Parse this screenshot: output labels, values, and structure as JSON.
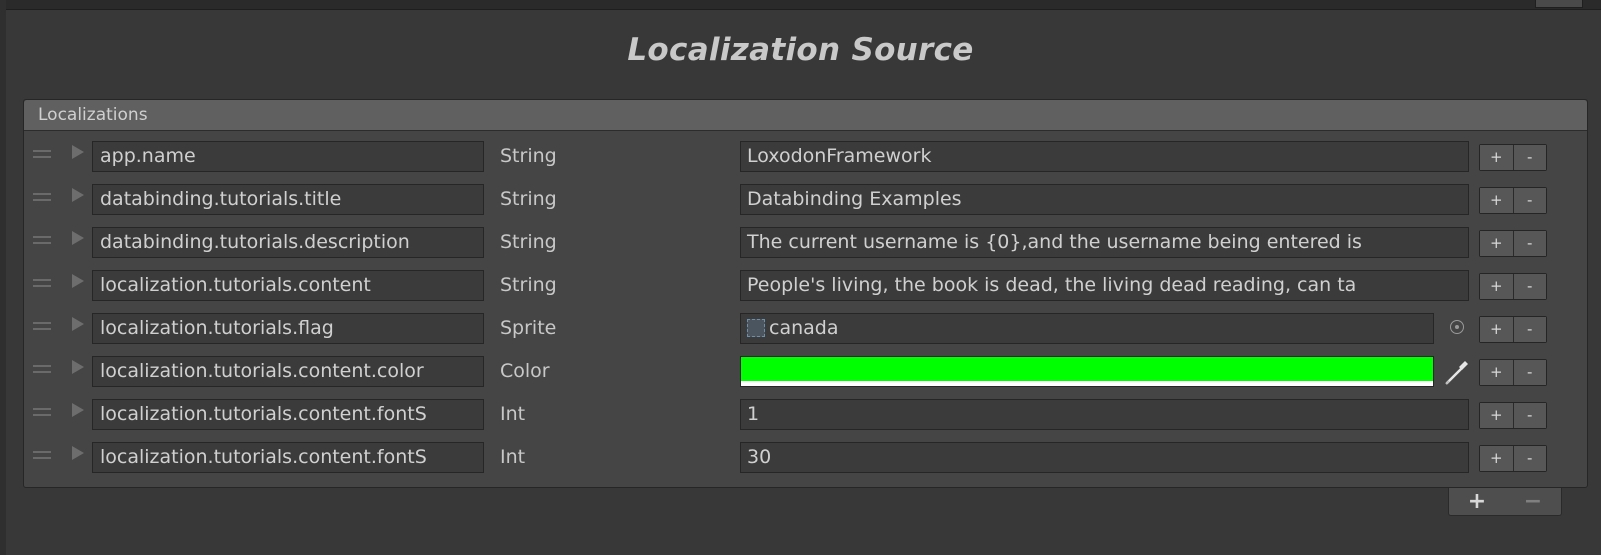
{
  "title": "Localization Source",
  "list": {
    "header": "Localizations",
    "rows": [
      {
        "key": "app.name",
        "type": "String",
        "value": "LoxodonFramework"
      },
      {
        "key": "databinding.tutorials.title",
        "type": "String",
        "value": "Databinding Examples"
      },
      {
        "key": "databinding.tutorials.description",
        "type": "String",
        "value": "The current username is {0},and the username being entered is"
      },
      {
        "key": "localization.tutorials.content",
        "type": "String",
        "value": "People's living, the book is dead, the living dead reading, can ta"
      },
      {
        "key": "localization.tutorials.flag",
        "type": "Sprite",
        "value": "canada"
      },
      {
        "key": "localization.tutorials.content.color",
        "type": "Color",
        "value_color": "#00ff00"
      },
      {
        "key": "localization.tutorials.content.fontS",
        "type": "Int",
        "value": "1"
      },
      {
        "key": "localization.tutorials.content.fontS",
        "type": "Int",
        "value": "30"
      }
    ],
    "row_add_label": "+",
    "row_remove_label": "-",
    "footer_add_label": "+",
    "footer_remove_label": "−"
  },
  "icons": {
    "drag": "drag-handle-icon",
    "foldout": "foldout-arrow-icon",
    "sprite": "sprite-icon",
    "object_picker": "object-picker-icon",
    "eyedropper": "eyedropper-icon"
  }
}
